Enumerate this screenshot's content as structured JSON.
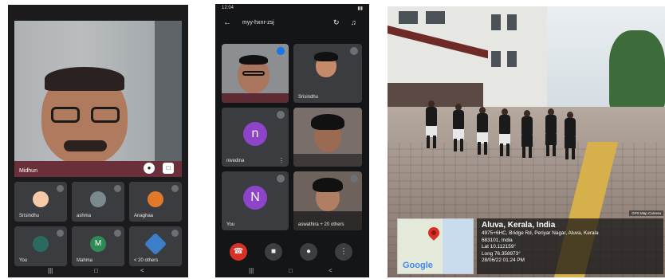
{
  "panel1": {
    "main_name": "Midhun",
    "tiles": [
      {
        "label": "Srisindhu",
        "avatar": "",
        "color": "#f5c9a8"
      },
      {
        "label": "ashma",
        "avatar": "",
        "color": "#7a8a8e"
      },
      {
        "label": "Anaghaa",
        "avatar": "",
        "color": "#e07a2a"
      },
      {
        "label": "You",
        "avatar": "",
        "color": "#2b6a5e"
      },
      {
        "label": "Mahma",
        "avatar": "M",
        "color": "#2e8b57"
      },
      {
        "label": "< 20 others",
        "avatar": "",
        "color": "#3d7ec9"
      }
    ],
    "icons": {
      "mic": "mic-icon",
      "expand": "expand-icon"
    }
  },
  "panel2": {
    "status_time": "12:04",
    "meeting_code": "myy-hxnr-zsj",
    "tiles": [
      {
        "label": "",
        "kind": "video"
      },
      {
        "label": "Srisindhu",
        "kind": "video"
      },
      {
        "label": "nivedina",
        "avatar": "n"
      },
      {
        "label": "",
        "kind": "video"
      },
      {
        "label": "You",
        "avatar": "N"
      },
      {
        "label": "aswathira + 20 others",
        "kind": "video"
      }
    ]
  },
  "panel3": {
    "place": "Aluva, Kerala, India",
    "address_line1": "4975+6HC, Bridge Rd, Periyar Nagar, Aluva, Kerala",
    "address_line2": "683101, India",
    "lat": "Lat 10.112159°",
    "long": "Long 76.358973°",
    "datetime": "28/06/22 01:24 PM",
    "map_logo": "Google",
    "app_badge": "GPS Map Camera"
  }
}
